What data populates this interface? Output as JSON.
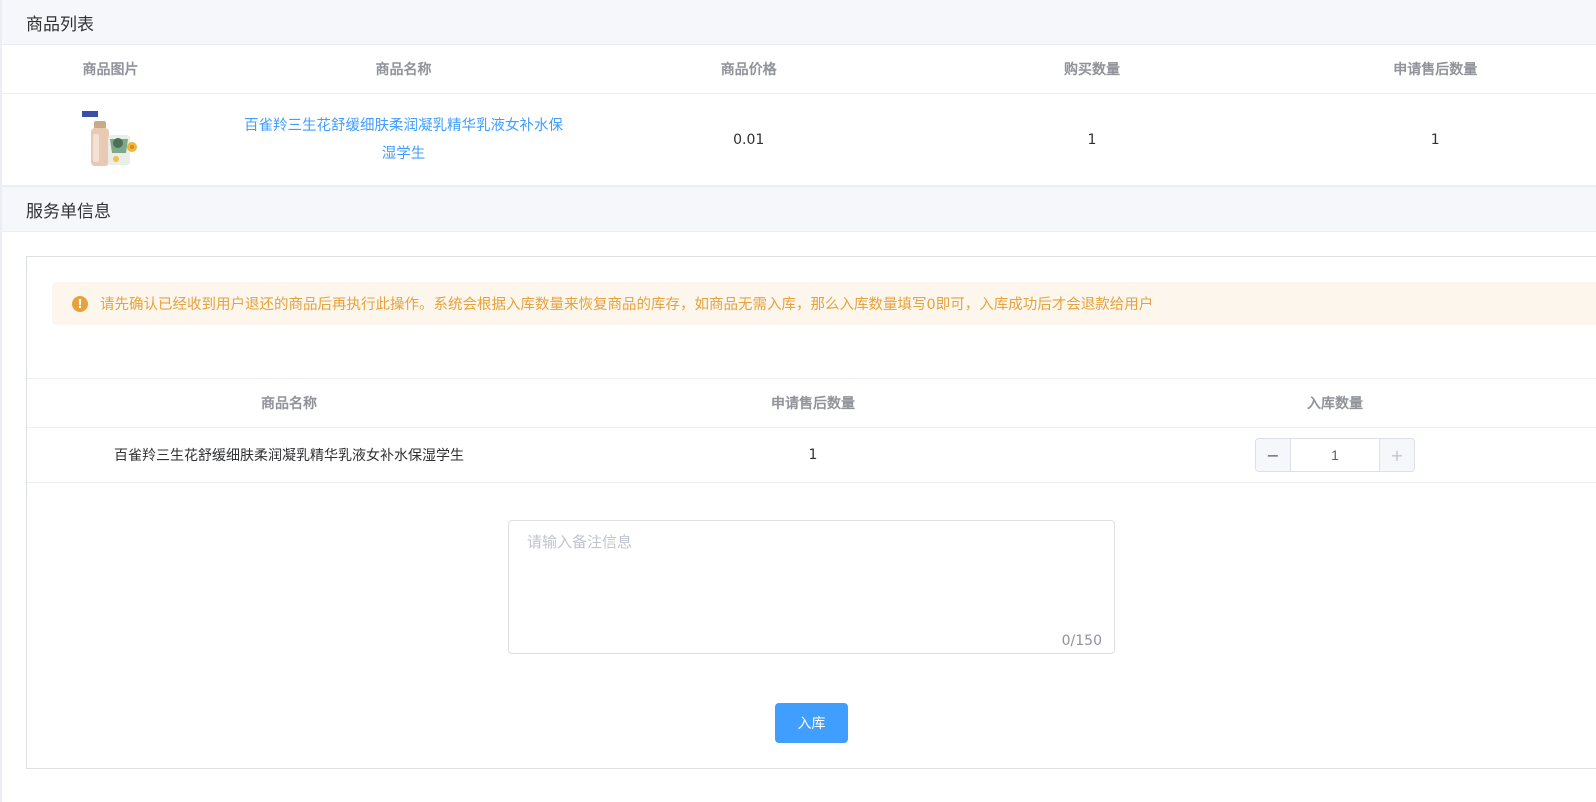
{
  "goods_section": {
    "title": "商品列表",
    "columns": [
      "商品图片",
      "商品名称",
      "商品价格",
      "购买数量",
      "申请售后数量"
    ],
    "rows": [
      {
        "image_icon": "product-bottle-image",
        "name": "百雀羚三生花舒缓细肤柔润凝乳精华乳液女补水保湿学生",
        "price": "0.01",
        "purchase_qty": "1",
        "aftersale_qty": "1"
      }
    ]
  },
  "service_section": {
    "title": "服务单信息",
    "alert": {
      "icon": "warning-icon",
      "text": "请先确认已经收到用户退还的商品后再执行此操作。系统会根据入库数量来恢复商品的库存，如商品无需入库，那么入库数量填写0即可，入库成功后才会退款给用户",
      "color": "#e6a23c"
    },
    "columns": [
      "商品名称",
      "申请售后数量",
      "入库数量"
    ],
    "rows": [
      {
        "name": "百雀羚三生花舒缓细肤柔润凝乳精华乳液女补水保湿学生",
        "aftersale_qty": "1",
        "stock_qty": "1"
      }
    ],
    "stepper": {
      "minus": "−",
      "plus": "+"
    },
    "remark": {
      "placeholder": "请输入备注信息",
      "value": "",
      "counter": "0/150"
    },
    "submit_label": "入库"
  },
  "colors": {
    "primary": "#409eff",
    "header_bg": "#f5f7fa",
    "border": "#ebeef5"
  }
}
